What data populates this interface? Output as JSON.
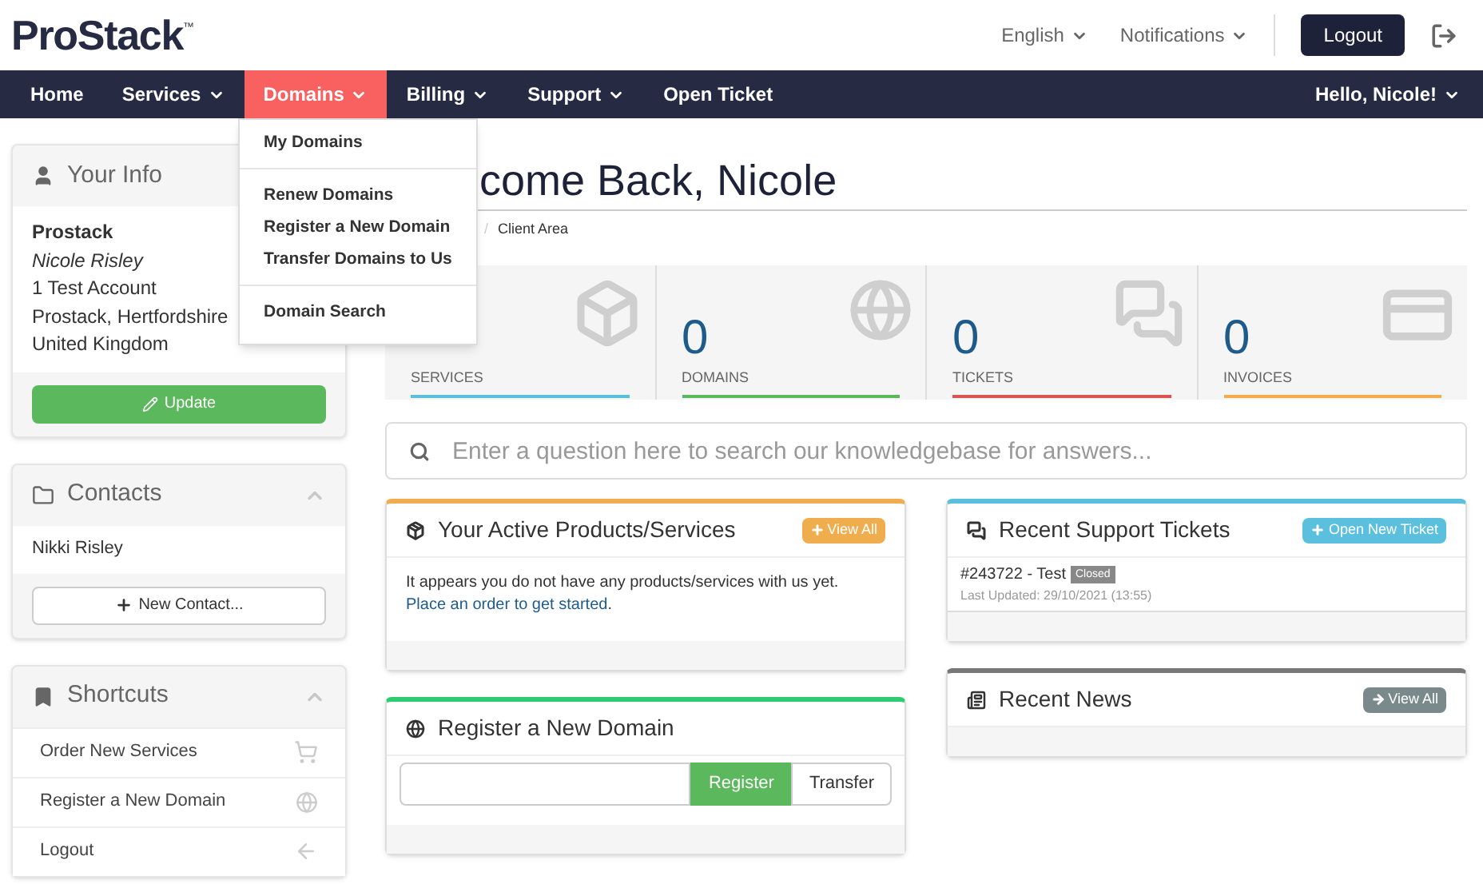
{
  "header": {
    "logo": "ProStack",
    "logo_mark": "™",
    "language": "English",
    "notifications": "Notifications",
    "logout": "Logout"
  },
  "nav": [
    {
      "label": "Home",
      "caret": false,
      "selected": false
    },
    {
      "label": "Services",
      "caret": true,
      "selected": false
    },
    {
      "label": "Domains",
      "caret": true,
      "selected": true
    },
    {
      "label": "Billing",
      "caret": true,
      "selected": false
    },
    {
      "label": "Support",
      "caret": true,
      "selected": false
    },
    {
      "label": "Open Ticket",
      "caret": false,
      "selected": false
    }
  ],
  "greeting": "Hello, Nicole!",
  "dropdown": {
    "groups": [
      [
        "My Domains"
      ],
      [
        "Renew Domains",
        "Register a New Domain",
        "Transfer Domains to Us"
      ],
      [
        "Domain Search"
      ]
    ]
  },
  "your_info": {
    "title": "Your Info",
    "company": "Prostack",
    "name": "Nicole Risley",
    "lines": [
      "1 Test Account",
      "Prostack, Hertfordshire",
      "United Kingdom"
    ],
    "button": "Update"
  },
  "contacts": {
    "title": "Contacts",
    "items": [
      "Nikki Risley"
    ],
    "button": "New Contact..."
  },
  "shortcuts": {
    "title": "Shortcuts",
    "items": [
      {
        "label": "Order New Services",
        "kind": "cart"
      },
      {
        "label": "Register a New Domain",
        "kind": "globe"
      },
      {
        "label": "Logout",
        "kind": "back"
      }
    ]
  },
  "page_title": "come Back, Nicole",
  "breadcrumb": {
    "separator": "/",
    "current": "Client Area"
  },
  "stats": [
    {
      "label": "SERVICES",
      "kind": "box",
      "color": "#5bc0de"
    },
    {
      "value": "0",
      "label": "DOMAINS",
      "kind": "globe",
      "color": "#5cb85c"
    },
    {
      "value": "0",
      "label": "TICKETS",
      "kind": "chat",
      "color": "#d9534f"
    },
    {
      "value": "0",
      "label": "INVOICES",
      "kind": "card",
      "color": "#f0ad4e"
    }
  ],
  "search": {
    "placeholder": "Enter a question here to search our knowledgebase for answers..."
  },
  "products": {
    "title": "Your Active Products/Services",
    "button": "View All",
    "text": "It appears you do not have any products/services with us yet.",
    "link": "Place an order to get started",
    "after": "."
  },
  "domain": {
    "title": "Register a New Domain",
    "register": "Register",
    "transfer": "Transfer"
  },
  "tickets": {
    "title": "Recent Support Tickets",
    "button": "Open New Ticket",
    "items": [
      {
        "subject": "#243722 - Test",
        "status": "Closed",
        "updated": "Last Updated: 29/10/2021 (13:55)"
      }
    ]
  },
  "news": {
    "title": "Recent News",
    "button": "View All"
  }
}
